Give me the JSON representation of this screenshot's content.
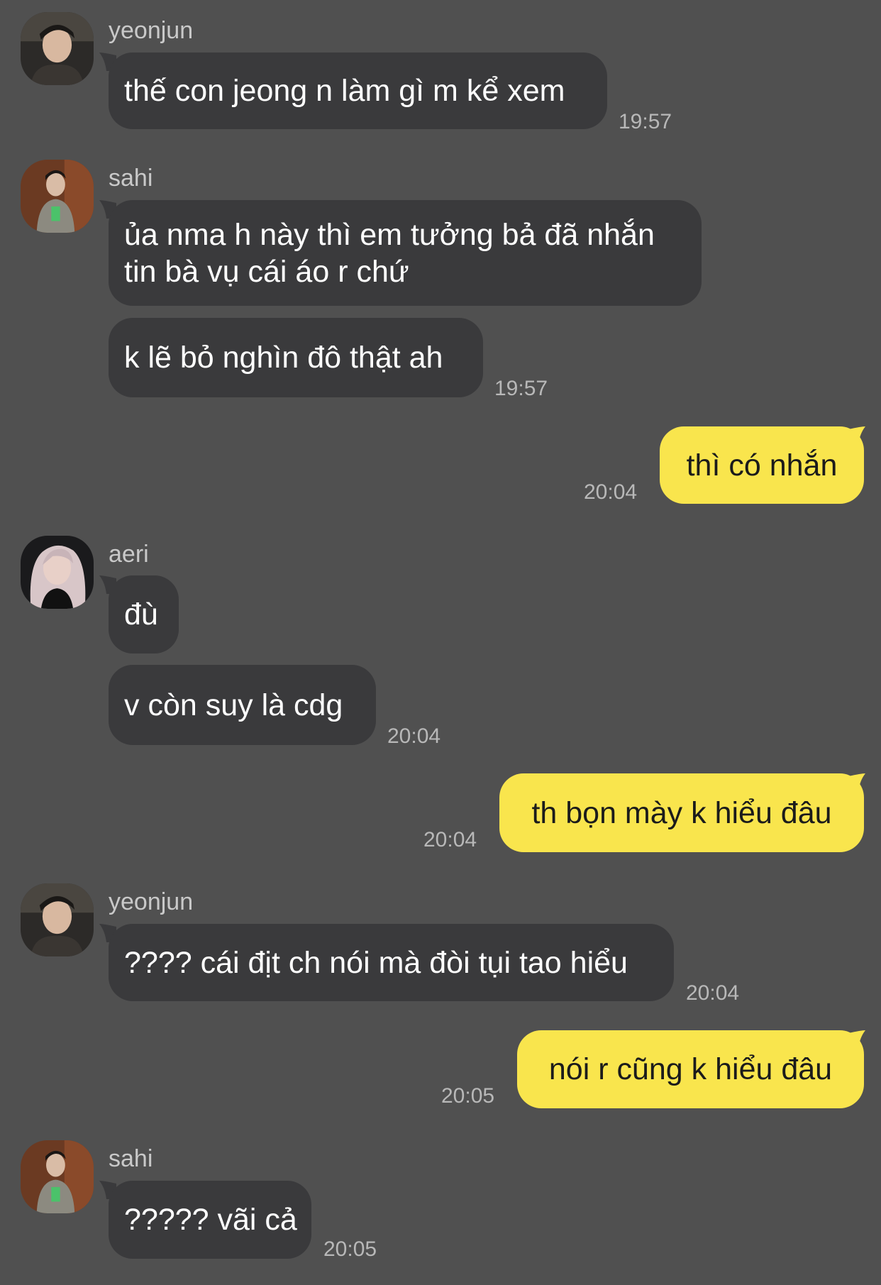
{
  "messages": [
    {
      "sender": "yeonjun",
      "text": "thế con jeong n làm gì m kể xem",
      "time": "19:57"
    },
    {
      "sender": "sahi",
      "line1": "ủa nma h này thì em tưởng bả đã nhắn",
      "line2": "tin bà vụ cái áo r chứ"
    },
    {
      "text": "k lẽ bỏ nghìn đô thật ah",
      "time": "19:57"
    },
    {
      "text": "thì có nhắn",
      "time": "20:04"
    },
    {
      "sender": "aeri",
      "text": "đù"
    },
    {
      "text": "v còn suy là cdg",
      "time": "20:04"
    },
    {
      "text": "th bọn mày k hiểu đâu",
      "time": "20:04"
    },
    {
      "sender": "yeonjun",
      "text": "???? cái địt ch nói mà đòi tụi tao hiểu",
      "time": "20:04"
    },
    {
      "text": "nói r cũng k hiểu đâu",
      "time": "20:05"
    },
    {
      "sender": "sahi",
      "text": "????? vãi cả",
      "time": "20:05"
    }
  ],
  "colors": {
    "background": "#505050",
    "incoming_bubble": "#3a3a3c",
    "outgoing_bubble": "#f9e54d",
    "sender_name": "#c9c9c9",
    "timestamp": "#b8b8b8"
  }
}
